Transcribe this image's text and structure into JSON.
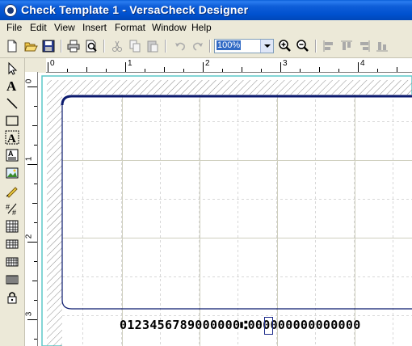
{
  "window": {
    "title": "Check Template 1 - VersaCheck Designer"
  },
  "menu": [
    "File",
    "Edit",
    "View",
    "Insert",
    "Format",
    "Window",
    "Help"
  ],
  "toolbar": {
    "zoom_value": "100%",
    "buttons": [
      "new-icon",
      "open-icon",
      "save-icon",
      "print-icon",
      "print-preview-icon",
      "cut-icon",
      "copy-icon",
      "paste-icon",
      "undo-icon",
      "redo-icon",
      "zoom-in-icon",
      "zoom-out-icon",
      "align-left-icon",
      "align-top-icon",
      "align-right-icon",
      "align-bottom-icon"
    ]
  },
  "tools": [
    "pointer-icon",
    "text-icon",
    "line-icon",
    "rectangle-icon",
    "text-frame-icon",
    "text-block-icon",
    "image-icon",
    "signature-icon",
    "numbering-icon",
    "table-icon",
    "grid-table-icon",
    "grid-table-2-icon",
    "barcode-icon",
    "lock-icon"
  ],
  "ruler": {
    "horizontal": [
      "0",
      "1",
      "2",
      "3",
      "4"
    ],
    "vertical": [
      "0",
      "1",
      "2",
      "3"
    ]
  },
  "check": {
    "micr_line": "0123456789000000⑆000000000000000"
  }
}
